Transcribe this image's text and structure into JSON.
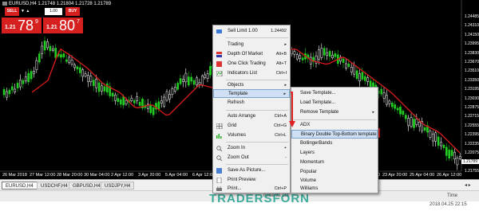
{
  "chart": {
    "title": "EURUSD,H4  1.21748  1.21804  1.21728  1.21789",
    "colors": {
      "background": "#000000",
      "bull": "#22cc22",
      "bear": "#ffffff",
      "ma": "#d11a1a",
      "accent_red": "#d61f1f",
      "highlight": "#cfe0f5"
    },
    "price_labels": [
      "1.24485",
      "1.24310",
      "1.24150",
      "1.23995",
      "1.23830",
      "1.23670",
      "1.23510",
      "1.23350",
      "1.23195",
      "1.23030",
      "1.22875",
      "1.22715",
      "1.22555",
      "1.22395",
      "1.22235",
      "1.22075",
      "1.21915",
      "1.21755"
    ],
    "current_price": "1.21789",
    "time_labels": [
      "26 Mar 2018",
      "27 Mar 12:00",
      "28 Mar 20:00",
      "30 Mar 04:00",
      "2 Apr 12:00",
      "3 Apr 20:00",
      "5 Apr 04:00",
      "6 Apr 12:00",
      "9 Apr 20:00",
      "12 Apr 04:00",
      "16 Apr 12:00",
      "17 Apr 20:00",
      "19 Apr 04:00",
      "20 Apr 12:00",
      "23 Apr 20:00",
      "25 Apr 04:00",
      "26 Apr 12:00"
    ]
  },
  "trade_panel": {
    "sell_label": "SELL",
    "buy_label": "BUY",
    "lot": "1.00",
    "sell_small": "1.21",
    "sell_big": "78",
    "sell_sup": "9",
    "buy_small": "1.21",
    "buy_big": "80",
    "buy_sup": "7"
  },
  "context_menu": {
    "items": [
      {
        "label": "Sell Limit 1.00",
        "shortcut": "1.24492",
        "icon": "order-icon"
      },
      {
        "label": "Trading",
        "arrow": true,
        "icon": "trading-icon"
      },
      {
        "label": "Depth Of Market",
        "shortcut": "Alt+B",
        "icon": "dom-icon"
      },
      {
        "label": "One Click Trading",
        "shortcut": "Alt+T",
        "icon": "one-click-icon"
      },
      {
        "label": "Indicators List",
        "shortcut": "Ctrl+I",
        "icon": "indicators-icon"
      },
      {
        "label": "Objects",
        "arrow": true,
        "icon": "objects-icon"
      },
      {
        "label": "Template",
        "arrow": true,
        "icon": "template-icon"
      },
      {
        "label": "Refresh",
        "icon": "refresh-icon"
      },
      {
        "label": "Auto Arrange",
        "shortcut": "Ctrl+A",
        "icon": "arrange-icon"
      },
      {
        "label": "Grid",
        "shortcut": "Ctrl+G",
        "icon": "grid-icon"
      },
      {
        "label": "Volumes",
        "shortcut": "Ctrl+L",
        "icon": "volumes-icon"
      },
      {
        "label": "Zoom In",
        "shortcut": "+",
        "icon": "zoom-in-icon"
      },
      {
        "label": "Zoom Out",
        "shortcut": "-",
        "icon": "zoom-out-icon"
      },
      {
        "label": "Save As Picture...",
        "icon": "save-picture-icon"
      },
      {
        "label": "Print Preview",
        "icon": "print-preview-icon"
      },
      {
        "label": "Print...",
        "shortcut": "Ctrl+P",
        "icon": "print-icon"
      }
    ]
  },
  "template_submenu": {
    "items": [
      {
        "label": "Save Template..."
      },
      {
        "label": "Load Template..."
      },
      {
        "label": "Remove Template",
        "arrow": true
      },
      {
        "label": "ADX"
      },
      {
        "label": "Binary Double Top-Bottom template"
      },
      {
        "label": "BollingerBands"
      },
      {
        "label": "Layers"
      },
      {
        "label": "Momentum"
      },
      {
        "label": "Popular"
      },
      {
        "label": "Volume"
      },
      {
        "label": "Williams"
      }
    ]
  },
  "tabs": {
    "items": [
      "EURUSD,H4",
      "USDCHF,H4",
      "GBPUSD,H4",
      "USDJPY,H4"
    ]
  },
  "status": {
    "time_label": "Time",
    "datetime": "2018.04.25 22:15",
    "company": "ruments Ltd"
  },
  "watermark": {
    "brand": "TRADERSFORN",
    "footer": "..."
  }
}
